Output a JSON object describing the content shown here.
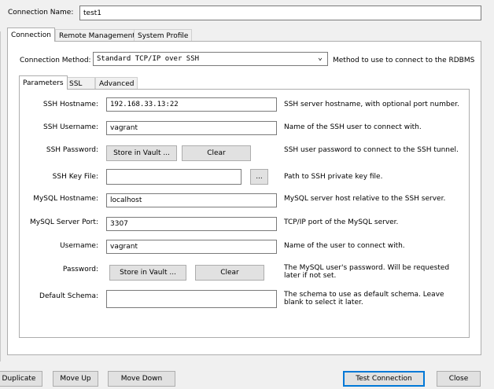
{
  "connection_name": {
    "label": "Connection Name:",
    "value": "test1"
  },
  "main_tabs": [
    "Connection",
    "Remote Management",
    "System Profile"
  ],
  "connection_method": {
    "label": "Connection Method:",
    "value": "Standard TCP/IP over SSH",
    "hint": "Method to use to connect to the RDBMS"
  },
  "sub_tabs": [
    "Parameters",
    "SSL",
    "Advanced"
  ],
  "fields": {
    "ssh_hostname": {
      "label": "SSH Hostname:",
      "value": "192.168.33.13:22",
      "desc": "SSH server hostname, with  optional port number."
    },
    "ssh_username": {
      "label": "SSH Username:",
      "value": "vagrant",
      "desc": "Name of the SSH user to connect with."
    },
    "ssh_password": {
      "label": "SSH Password:",
      "store": "Store in Vault ...",
      "clear": "Clear",
      "desc": "SSH user password to connect to the SSH tunnel."
    },
    "ssh_key_file": {
      "label": "SSH Key File:",
      "value": "",
      "browse": "...",
      "desc": "Path to SSH private key file."
    },
    "mysql_hostname": {
      "label": "MySQL Hostname:",
      "value": "localhost",
      "desc": "MySQL server host relative to the SSH server."
    },
    "mysql_port": {
      "label": "MySQL Server Port:",
      "value": "3307",
      "desc": "TCP/IP port of the MySQL server."
    },
    "username": {
      "label": "Username:",
      "value": "vagrant",
      "desc": "Name of the user to connect with."
    },
    "password": {
      "label": "Password:",
      "store": "Store in Vault ...",
      "clear": "Clear",
      "desc": "The MySQL user's password. Will be requested later if not set."
    },
    "default_schema": {
      "label": "Default Schema:",
      "value": "",
      "desc": "The schema to use as default schema. Leave blank to select it later."
    }
  },
  "footer": {
    "duplicate": "Duplicate",
    "move_up": "Move Up",
    "move_down": "Move Down",
    "test_connection": "Test Connection",
    "close": "Close"
  }
}
